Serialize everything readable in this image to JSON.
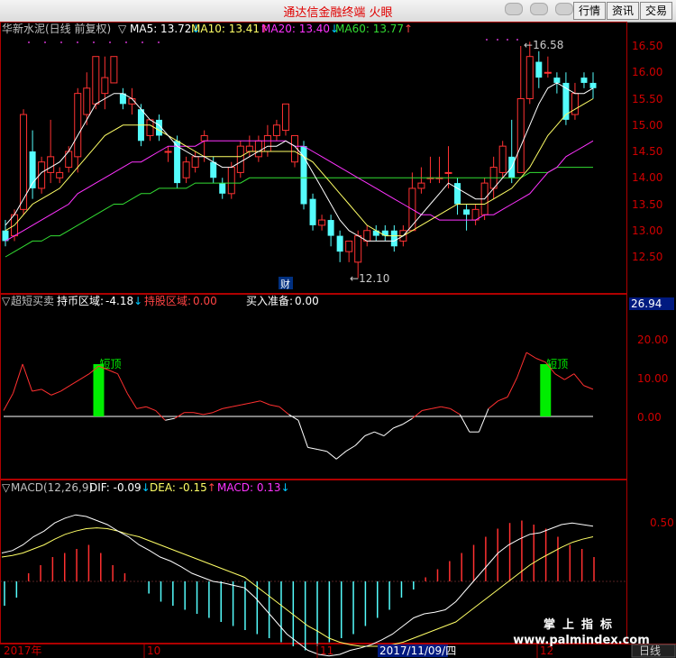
{
  "window": {
    "title": "通达信金融终端  火眼",
    "buttons": [
      "行情",
      "资讯",
      "交易"
    ]
  },
  "price_panel": {
    "stock_label": "华新水泥(日线 前复权)",
    "indicators": [
      {
        "label": "MA5: 13.72",
        "arrow": "↓",
        "color": "#ffffff"
      },
      {
        "label": "MA10: 13.41",
        "arrow": "↑",
        "color": "#ffff66"
      },
      {
        "label": "MA20: 13.40",
        "arrow": "↓",
        "color": "#ff33ff"
      },
      {
        "label": "MA60: 13.77",
        "arrow": "↑",
        "color": "#33dd33"
      }
    ],
    "high_marker": "16.58",
    "low_marker": "12.10",
    "event_marker": "财",
    "yticks": [
      "16.50",
      "16.00",
      "15.50",
      "15.00",
      "14.50",
      "14.00",
      "13.50",
      "13.00",
      "12.50"
    ]
  },
  "osc_panel": {
    "name": "超短买卖",
    "hold_label": "持币区域:",
    "hold_value": "-4.18",
    "hold_arrow": "↓",
    "share_label": "持股区域:",
    "share_value": "0.00",
    "buy_label": "买入准备:",
    "buy_value": "0.00",
    "current_value": "26.94",
    "signal_labels": [
      "短顶",
      "短顶"
    ],
    "yticks": [
      "20.00",
      "10.00",
      "0.00"
    ]
  },
  "macd_panel": {
    "name": "MACD(12,26,9)",
    "dif_label": "DIF: -0.09",
    "dif_arrow": "↓",
    "dea_label": "DEA: -0.15",
    "dea_arrow": "↑",
    "macd_label": "MACD: 0.13",
    "macd_arrow": "↓",
    "yticks": [
      "0.50"
    ]
  },
  "x_axis": {
    "labels": [
      "2017年",
      "10",
      "11",
      "2017/11/09/四",
      "12"
    ],
    "period": "日线"
  },
  "watermark": {
    "cn": "掌上指标",
    "url": "www.palmindex.com"
  },
  "chart_data": {
    "type": "candlestick",
    "candles": [
      [
        13.0,
        12.8,
        13.2,
        12.7
      ],
      [
        12.9,
        13.3,
        13.4,
        12.8
      ],
      [
        13.4,
        15.2,
        15.3,
        13.3
      ],
      [
        14.5,
        13.8,
        14.9,
        13.6
      ],
      [
        13.8,
        14.3,
        14.4,
        13.7
      ],
      [
        14.1,
        14.4,
        15.1,
        13.9
      ],
      [
        14.0,
        14.1,
        14.2,
        13.9
      ],
      [
        14.2,
        14.5,
        14.6,
        14.1
      ],
      [
        14.4,
        15.6,
        15.7,
        14.1
      ],
      [
        15.2,
        15.7,
        16.0,
        15.0
      ],
      [
        15.4,
        16.3,
        16.3,
        15.3
      ],
      [
        15.6,
        15.9,
        16.3,
        15.3
      ],
      [
        15.8,
        16.3,
        16.2,
        15.8
      ],
      [
        15.6,
        15.4,
        15.7,
        15.3
      ],
      [
        15.4,
        15.5,
        15.7,
        15.2
      ],
      [
        15.3,
        14.7,
        15.4,
        14.6
      ],
      [
        14.8,
        15.1,
        15.1,
        14.7
      ],
      [
        15.1,
        14.8,
        15.2,
        14.7
      ],
      [
        14.5,
        14.5,
        14.6,
        14.3
      ],
      [
        14.7,
        13.9,
        14.8,
        13.8
      ],
      [
        14.0,
        14.3,
        14.4,
        13.9
      ],
      [
        14.2,
        14.4,
        14.5,
        14.1
      ],
      [
        14.7,
        14.8,
        14.9,
        14.3
      ],
      [
        14.3,
        14.0,
        14.4,
        13.9
      ],
      [
        13.9,
        13.7,
        14.0,
        13.6
      ],
      [
        13.7,
        14.2,
        14.3,
        13.6
      ],
      [
        14.1,
        14.6,
        14.7,
        14.0
      ],
      [
        14.5,
        14.6,
        14.8,
        14.4
      ],
      [
        14.4,
        14.7,
        14.8,
        14.3
      ],
      [
        14.5,
        14.8,
        15.0,
        14.4
      ],
      [
        14.8,
        15.0,
        15.1,
        14.7
      ],
      [
        14.9,
        15.4,
        15.2,
        14.8
      ],
      [
        14.3,
        14.8,
        14.8,
        14.2
      ],
      [
        14.6,
        13.5,
        14.7,
        13.4
      ],
      [
        13.6,
        13.1,
        13.7,
        13.0
      ],
      [
        13.1,
        13.2,
        13.3,
        13.0
      ],
      [
        13.2,
        12.9,
        13.3,
        12.7
      ],
      [
        12.9,
        12.6,
        13.0,
        12.4
      ],
      [
        12.6,
        12.8,
        12.8,
        12.4
      ],
      [
        12.4,
        12.9,
        13.0,
        12.1
      ],
      [
        12.8,
        13.0,
        13.1,
        12.7
      ],
      [
        13.0,
        12.9,
        13.1,
        12.8
      ],
      [
        13.0,
        12.9,
        13.1,
        12.8
      ],
      [
        13.0,
        12.7,
        13.1,
        12.6
      ],
      [
        12.8,
        13.0,
        13.1,
        12.7
      ],
      [
        13.0,
        13.8,
        14.1,
        13.0
      ],
      [
        13.8,
        13.9,
        14.2,
        13.7
      ],
      [
        14.0,
        14.0,
        14.4,
        13.9
      ],
      [
        14.0,
        14.0,
        14.4,
        13.9
      ],
      [
        14.1,
        14.1,
        14.6,
        13.8
      ],
      [
        13.9,
        13.5,
        14.0,
        13.3
      ],
      [
        13.4,
        13.3,
        13.5,
        13.0
      ],
      [
        13.2,
        13.4,
        13.5,
        13.1
      ],
      [
        13.3,
        13.9,
        14.0,
        13.2
      ],
      [
        13.8,
        14.2,
        14.4,
        13.6
      ],
      [
        14.1,
        14.6,
        14.7,
        14.0
      ],
      [
        14.4,
        14.0,
        15.1,
        13.9
      ],
      [
        14.1,
        15.5,
        16.5,
        14.1
      ],
      [
        15.5,
        16.3,
        16.58,
        15.4
      ],
      [
        16.2,
        15.9,
        16.4,
        15.7
      ],
      [
        16.0,
        16.0,
        16.3,
        15.9
      ],
      [
        15.9,
        15.8,
        16.0,
        15.6
      ],
      [
        15.8,
        15.1,
        16.0,
        15.0
      ],
      [
        15.2,
        15.6,
        15.8,
        15.1
      ],
      [
        15.9,
        15.8,
        16.0,
        15.7
      ],
      [
        15.8,
        15.7,
        16.0,
        15.5
      ]
    ],
    "ma5": [
      13.1,
      13.3,
      13.6,
      13.9,
      14.1,
      14.2,
      14.3,
      14.5,
      14.8,
      15.1,
      15.4,
      15.5,
      15.6,
      15.6,
      15.5,
      15.3,
      15.1,
      15.0,
      14.8,
      14.6,
      14.5,
      14.4,
      14.4,
      14.3,
      14.2,
      14.2,
      14.3,
      14.4,
      14.5,
      14.6,
      14.6,
      14.7,
      14.6,
      14.4,
      14.1,
      13.8,
      13.5,
      13.2,
      13.0,
      12.9,
      12.8,
      12.8,
      12.8,
      12.8,
      12.9,
      13.1,
      13.3,
      13.5,
      13.7,
      13.9,
      13.8,
      13.7,
      13.6,
      13.6,
      13.8,
      14.0,
      14.2,
      14.6,
      15.0,
      15.4,
      15.7,
      15.8,
      15.7,
      15.6,
      15.6,
      15.7
    ],
    "ma10": [
      13.0,
      13.1,
      13.3,
      13.5,
      13.6,
      13.7,
      13.8,
      14.0,
      14.2,
      14.4,
      14.6,
      14.8,
      14.9,
      15.0,
      15.0,
      15.0,
      15.0,
      14.9,
      14.8,
      14.7,
      14.6,
      14.5,
      14.4,
      14.4,
      14.4,
      14.4,
      14.4,
      14.5,
      14.5,
      14.5,
      14.5,
      14.5,
      14.5,
      14.4,
      14.3,
      14.1,
      13.9,
      13.7,
      13.5,
      13.3,
      13.1,
      13.0,
      12.9,
      12.9,
      12.9,
      13.0,
      13.1,
      13.2,
      13.3,
      13.4,
      13.5,
      13.5,
      13.5,
      13.5,
      13.6,
      13.7,
      13.8,
      14.0,
      14.2,
      14.5,
      14.8,
      15.0,
      15.2,
      15.3,
      15.4,
      15.5
    ],
    "ma20": [
      12.8,
      12.9,
      13.0,
      13.1,
      13.2,
      13.3,
      13.4,
      13.5,
      13.7,
      13.8,
      13.9,
      14.0,
      14.1,
      14.2,
      14.3,
      14.3,
      14.4,
      14.5,
      14.6,
      14.6,
      14.6,
      14.6,
      14.7,
      14.7,
      14.7,
      14.7,
      14.7,
      14.7,
      14.7,
      14.7,
      14.7,
      14.7,
      14.6,
      14.6,
      14.5,
      14.4,
      14.3,
      14.2,
      14.1,
      14.0,
      13.9,
      13.8,
      13.7,
      13.6,
      13.5,
      13.4,
      13.3,
      13.3,
      13.2,
      13.2,
      13.2,
      13.2,
      13.2,
      13.3,
      13.3,
      13.4,
      13.5,
      13.6,
      13.7,
      13.9,
      14.1,
      14.2,
      14.4,
      14.5,
      14.6,
      14.7
    ],
    "ma60": [
      12.5,
      12.6,
      12.7,
      12.8,
      12.8,
      12.9,
      12.9,
      13.0,
      13.1,
      13.2,
      13.3,
      13.4,
      13.5,
      13.5,
      13.6,
      13.7,
      13.7,
      13.8,
      13.8,
      13.8,
      13.8,
      13.9,
      13.9,
      13.9,
      13.9,
      13.9,
      13.9,
      14.0,
      14.0,
      14.0,
      14.0,
      14.0,
      14.0,
      14.0,
      14.0,
      14.0,
      14.0,
      14.0,
      14.0,
      14.0,
      14.0,
      14.0,
      14.0,
      14.0,
      14.0,
      14.0,
      14.0,
      14.0,
      14.0,
      14.0,
      14.0,
      14.0,
      14.0,
      14.0,
      14.0,
      14.0,
      14.0,
      14.0,
      14.1,
      14.1,
      14.1,
      14.2,
      14.2,
      14.2,
      14.2,
      14.2
    ],
    "osc": [
      1.5,
      6.0,
      13.5,
      6.5,
      7.0,
      5.5,
      6.5,
      8.0,
      9.5,
      11.0,
      13.0,
      12.0,
      11.0,
      6.0,
      2.0,
      2.5,
      1.5,
      -1.0,
      -0.5,
      1.0,
      1.0,
      0.5,
      1.0,
      2.0,
      2.5,
      3.0,
      3.5,
      4.0,
      3.0,
      2.5,
      0.5,
      -1.0,
      -8.0,
      -8.5,
      -9.0,
      -11.0,
      -9.0,
      -7.5,
      -5.0,
      -4.0,
      -5.0,
      -3.0,
      -2.0,
      -0.5,
      1.5,
      2.0,
      2.5,
      2.0,
      0.5,
      -4.0,
      -4.0,
      2.0,
      4.0,
      5.0,
      10.0,
      16.5,
      15.0,
      14.0,
      11.0,
      9.5,
      11.0,
      8.0,
      7.0
    ],
    "signals": [
      10,
      57
    ],
    "dif": [
      0.35,
      0.38,
      0.45,
      0.55,
      0.62,
      0.72,
      0.78,
      0.82,
      0.8,
      0.75,
      0.7,
      0.62,
      0.55,
      0.45,
      0.38,
      0.3,
      0.25,
      0.18,
      0.1,
      0.05,
      0.0,
      -0.02,
      -0.05,
      -0.08,
      -0.2,
      -0.35,
      -0.5,
      -0.65,
      -0.75,
      -0.85,
      -0.9,
      -0.92,
      -0.9,
      -0.85,
      -0.82,
      -0.78,
      -0.72,
      -0.65,
      -0.55,
      -0.45,
      -0.4,
      -0.38,
      -0.35,
      -0.25,
      -0.1,
      0.05,
      0.2,
      0.35,
      0.45,
      0.52,
      0.58,
      0.6,
      0.65,
      0.7,
      0.72,
      0.7,
      0.68
    ],
    "dea": [
      0.3,
      0.32,
      0.35,
      0.4,
      0.45,
      0.52,
      0.58,
      0.62,
      0.65,
      0.66,
      0.65,
      0.62,
      0.58,
      0.55,
      0.5,
      0.45,
      0.4,
      0.35,
      0.3,
      0.25,
      0.2,
      0.15,
      0.1,
      0.05,
      -0.05,
      -0.15,
      -0.25,
      -0.35,
      -0.45,
      -0.55,
      -0.62,
      -0.7,
      -0.75,
      -0.78,
      -0.8,
      -0.8,
      -0.8,
      -0.78,
      -0.75,
      -0.7,
      -0.65,
      -0.6,
      -0.55,
      -0.5,
      -0.4,
      -0.3,
      -0.2,
      -0.1,
      0.0,
      0.1,
      0.2,
      0.28,
      0.35,
      0.42,
      0.48,
      0.52,
      0.55
    ],
    "macd": [
      -0.3,
      -0.2,
      0.1,
      0.2,
      0.3,
      0.35,
      0.4,
      0.45,
      0.35,
      0.2,
      0.1,
      0.0,
      -0.15,
      -0.25,
      -0.3,
      -0.35,
      -0.4,
      -0.45,
      -0.5,
      -0.55,
      -0.6,
      -0.65,
      -0.7,
      -0.75,
      -0.8,
      -0.85,
      -0.8,
      -0.75,
      -0.7,
      -0.65,
      -0.55,
      -0.45,
      -0.35,
      -0.2,
      -0.1,
      0.05,
      0.15,
      0.25,
      0.35,
      0.45,
      0.55,
      0.65,
      0.72,
      0.75,
      0.7,
      0.65,
      0.55,
      0.45,
      0.4,
      0.3
    ]
  }
}
